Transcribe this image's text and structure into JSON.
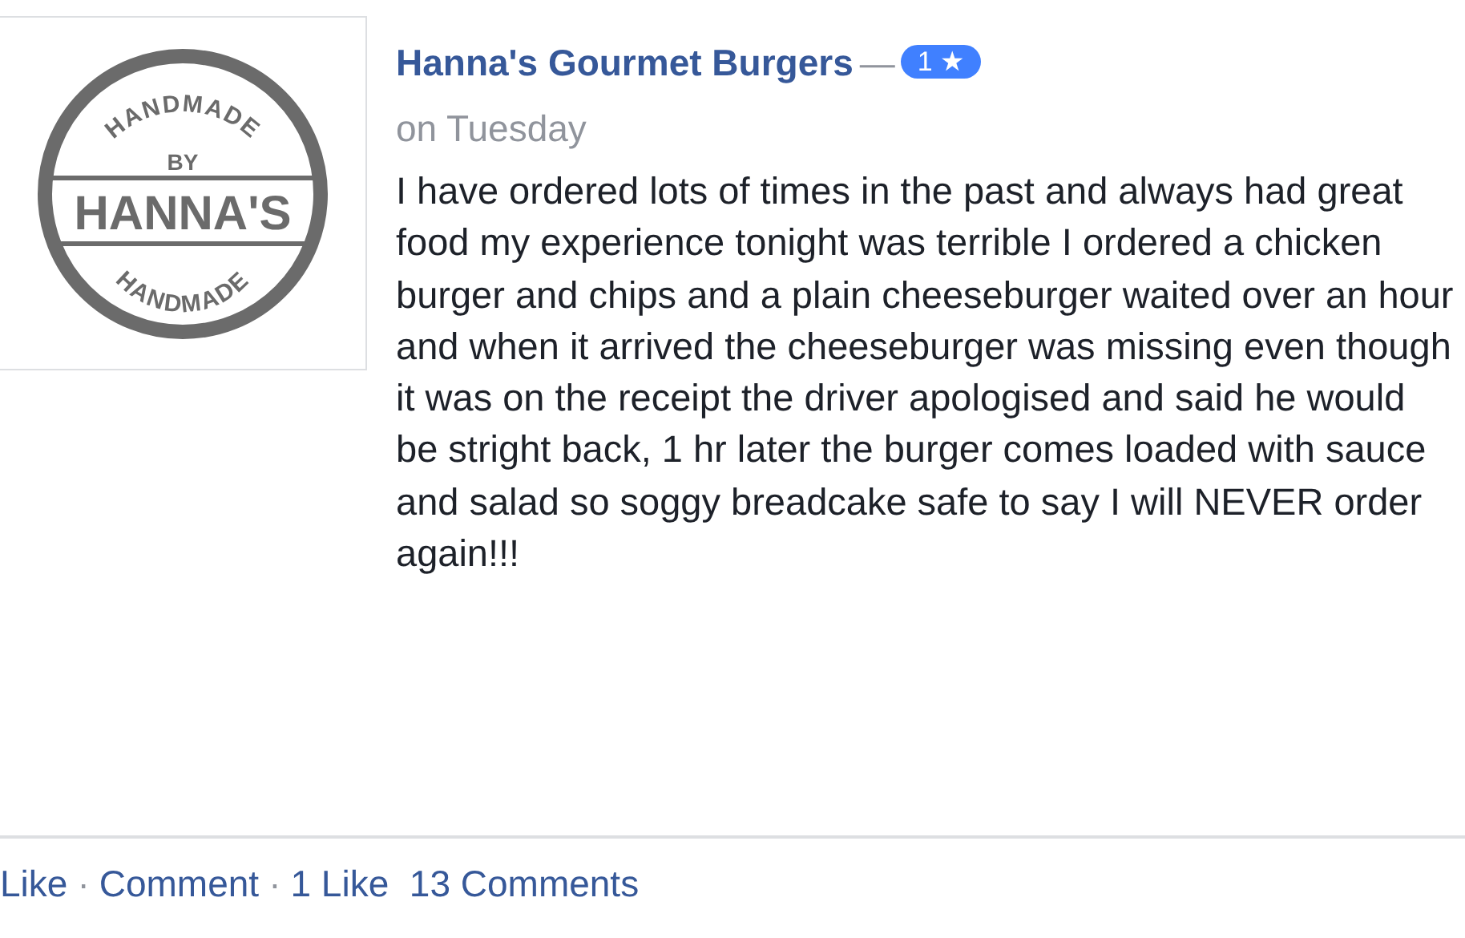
{
  "logo": {
    "top_text": "HANDMADE",
    "middle_text": "BY",
    "banner_text": "HANNA'S",
    "bottom_text": "HANDMADE"
  },
  "review": {
    "author": "Hanna's Gourmet Burgers",
    "separator": "—",
    "rating": "1",
    "rating_icon": "★",
    "time": "on Tuesday",
    "body": "I have ordered lots of times in the past and always had great food my experience tonight was terrible I ordered a chicken burger and chips and a plain cheeseburger waited over an hour and when it arrived the cheeseburger was missing even though it was on the receipt the driver apologised and said he would be stright back, 1 hr later the burger comes loaded with sauce and salad so soggy breadcake safe to say I will NEVER order again!!!"
  },
  "actions": [
    {
      "label": "Like"
    },
    {
      "label": "Comment"
    },
    {
      "label": "1 Like"
    },
    {
      "label": "13 Comments"
    }
  ],
  "action_separator": "·"
}
